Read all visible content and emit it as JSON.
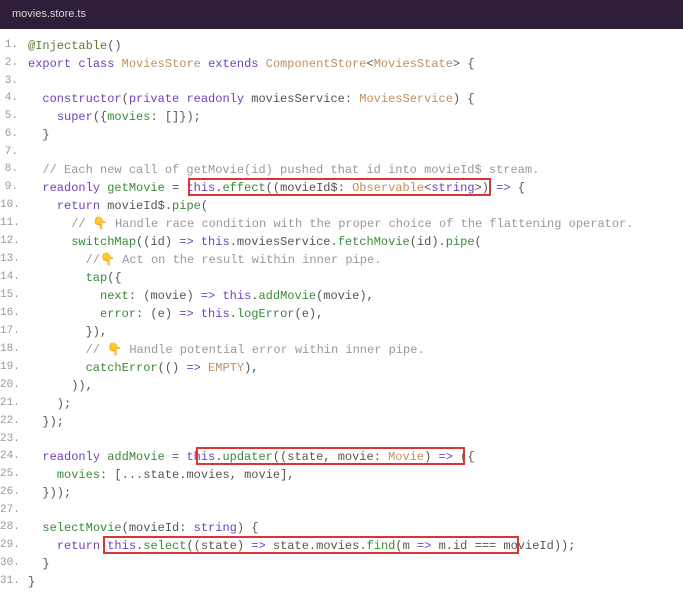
{
  "header": {
    "filename": "movies.store.ts"
  },
  "code": {
    "lines": [
      {
        "n": 1,
        "tokens": [
          [
            "@Injectable",
            "k-decorator"
          ],
          [
            "()",
            "k-punct"
          ]
        ]
      },
      {
        "n": 2,
        "tokens": [
          [
            "export ",
            "k-keyword"
          ],
          [
            "class ",
            "k-keyword"
          ],
          [
            "MoviesStore ",
            "k-class"
          ],
          [
            "extends ",
            "k-keyword"
          ],
          [
            "ComponentStore",
            "k-class"
          ],
          [
            "<",
            "k-punct"
          ],
          [
            "MoviesState",
            "k-class"
          ],
          [
            ">",
            "k-punct"
          ],
          [
            " {",
            "k-punct"
          ]
        ]
      },
      {
        "n": 3,
        "tokens": []
      },
      {
        "n": 4,
        "tokens": [
          [
            "  ",
            "k-plain"
          ],
          [
            "constructor",
            "k-keyword"
          ],
          [
            "(",
            "k-punct"
          ],
          [
            "private ",
            "k-keyword"
          ],
          [
            "readonly ",
            "k-keyword"
          ],
          [
            "moviesService",
            "k-plain"
          ],
          [
            ": ",
            "k-punct"
          ],
          [
            "MoviesService",
            "k-class"
          ],
          [
            ")",
            "k-punct"
          ],
          [
            " {",
            "k-punct"
          ]
        ]
      },
      {
        "n": 5,
        "tokens": [
          [
            "    ",
            "k-plain"
          ],
          [
            "super",
            "k-keyword"
          ],
          [
            "({",
            "k-punct"
          ],
          [
            "movies",
            "k-prop"
          ],
          [
            ": []});",
            "k-punct"
          ]
        ]
      },
      {
        "n": 6,
        "tokens": [
          [
            "  }",
            "k-punct"
          ]
        ]
      },
      {
        "n": 7,
        "tokens": []
      },
      {
        "n": 8,
        "tokens": [
          [
            "  ",
            "k-plain"
          ],
          [
            "// Each new call of getMovie(id) pushed that id into movieId$ stream.",
            "k-comment"
          ]
        ]
      },
      {
        "n": 9,
        "tokens": [
          [
            "  ",
            "k-plain"
          ],
          [
            "readonly ",
            "k-keyword"
          ],
          [
            "getMovie",
            "k-prop"
          ],
          [
            " = ",
            "k-punct"
          ],
          [
            "this",
            "k-this"
          ],
          [
            ".",
            "k-punct"
          ],
          [
            "effect",
            "k-method"
          ],
          [
            "((",
            "k-punct"
          ],
          [
            "movieId$",
            "k-plain"
          ],
          [
            ": ",
            "k-punct"
          ],
          [
            "Observable",
            "k-class"
          ],
          [
            "<",
            "k-punct"
          ],
          [
            "string",
            "k-type"
          ],
          [
            ">) ",
            "k-punct"
          ],
          [
            "=>",
            "k-keyword"
          ],
          [
            " {",
            "k-punct"
          ]
        ],
        "highlight": "hl1"
      },
      {
        "n": 10,
        "tokens": [
          [
            "    ",
            "k-plain"
          ],
          [
            "return ",
            "k-keyword"
          ],
          [
            "movieId$",
            "k-plain"
          ],
          [
            ".",
            "k-punct"
          ],
          [
            "pipe",
            "k-method"
          ],
          [
            "(",
            "k-punct"
          ]
        ]
      },
      {
        "n": 11,
        "tokens": [
          [
            "      ",
            "k-plain"
          ],
          [
            "// 👇 Handle race condition with the proper choice of the flattening operator.",
            "k-comment"
          ]
        ]
      },
      {
        "n": 12,
        "tokens": [
          [
            "      ",
            "k-plain"
          ],
          [
            "switchMap",
            "k-method"
          ],
          [
            "((",
            "k-punct"
          ],
          [
            "id",
            "k-plain"
          ],
          [
            ") ",
            "k-punct"
          ],
          [
            "=>",
            "k-keyword"
          ],
          [
            " ",
            "k-plain"
          ],
          [
            "this",
            "k-this"
          ],
          [
            ".",
            "k-punct"
          ],
          [
            "moviesService",
            "k-plain"
          ],
          [
            ".",
            "k-punct"
          ],
          [
            "fetchMovie",
            "k-method"
          ],
          [
            "(",
            "k-punct"
          ],
          [
            "id",
            "k-plain"
          ],
          [
            ").",
            "k-punct"
          ],
          [
            "pipe",
            "k-method"
          ],
          [
            "(",
            "k-punct"
          ]
        ]
      },
      {
        "n": 13,
        "tokens": [
          [
            "        ",
            "k-plain"
          ],
          [
            "//👇 Act on the result within inner pipe.",
            "k-comment"
          ]
        ]
      },
      {
        "n": 14,
        "tokens": [
          [
            "        ",
            "k-plain"
          ],
          [
            "tap",
            "k-method"
          ],
          [
            "({",
            "k-punct"
          ]
        ]
      },
      {
        "n": 15,
        "tokens": [
          [
            "          ",
            "k-plain"
          ],
          [
            "next",
            "k-prop"
          ],
          [
            ": (",
            "k-punct"
          ],
          [
            "movie",
            "k-plain"
          ],
          [
            ") ",
            "k-punct"
          ],
          [
            "=>",
            "k-keyword"
          ],
          [
            " ",
            "k-plain"
          ],
          [
            "this",
            "k-this"
          ],
          [
            ".",
            "k-punct"
          ],
          [
            "addMovie",
            "k-method"
          ],
          [
            "(",
            "k-punct"
          ],
          [
            "movie",
            "k-plain"
          ],
          [
            "),",
            "k-punct"
          ]
        ]
      },
      {
        "n": 16,
        "tokens": [
          [
            "          ",
            "k-plain"
          ],
          [
            "error",
            "k-prop"
          ],
          [
            ": (",
            "k-punct"
          ],
          [
            "e",
            "k-plain"
          ],
          [
            ") ",
            "k-punct"
          ],
          [
            "=>",
            "k-keyword"
          ],
          [
            " ",
            "k-plain"
          ],
          [
            "this",
            "k-this"
          ],
          [
            ".",
            "k-punct"
          ],
          [
            "logError",
            "k-method"
          ],
          [
            "(",
            "k-punct"
          ],
          [
            "e",
            "k-plain"
          ],
          [
            "),",
            "k-punct"
          ]
        ]
      },
      {
        "n": 17,
        "tokens": [
          [
            "        }),",
            "k-punct"
          ]
        ]
      },
      {
        "n": 18,
        "tokens": [
          [
            "        ",
            "k-plain"
          ],
          [
            "// 👇 Handle potential error within inner pipe.",
            "k-comment"
          ]
        ]
      },
      {
        "n": 19,
        "tokens": [
          [
            "        ",
            "k-plain"
          ],
          [
            "catchError",
            "k-method"
          ],
          [
            "(() ",
            "k-punct"
          ],
          [
            "=>",
            "k-keyword"
          ],
          [
            " ",
            "k-plain"
          ],
          [
            "EMPTY",
            "k-class"
          ],
          [
            "),",
            "k-punct"
          ]
        ]
      },
      {
        "n": 20,
        "tokens": [
          [
            "      )),",
            "k-punct"
          ]
        ]
      },
      {
        "n": 21,
        "tokens": [
          [
            "    );",
            "k-punct"
          ]
        ]
      },
      {
        "n": 22,
        "tokens": [
          [
            "  });",
            "k-punct"
          ]
        ]
      },
      {
        "n": 23,
        "tokens": []
      },
      {
        "n": 24,
        "tokens": [
          [
            "  ",
            "k-plain"
          ],
          [
            "readonly ",
            "k-keyword"
          ],
          [
            "addMovie",
            "k-prop"
          ],
          [
            " = ",
            "k-punct"
          ],
          [
            "this",
            "k-this"
          ],
          [
            ".",
            "k-punct"
          ],
          [
            "updater",
            "k-method"
          ],
          [
            "((",
            "k-punct"
          ],
          [
            "state",
            "k-plain"
          ],
          [
            ", ",
            "k-punct"
          ],
          [
            "movie",
            "k-plain"
          ],
          [
            ": ",
            "k-punct"
          ],
          [
            "Movie",
            "k-class"
          ],
          [
            ") ",
            "k-punct"
          ],
          [
            "=>",
            "k-keyword"
          ],
          [
            " ({",
            "k-punct"
          ]
        ],
        "highlight": "hl2"
      },
      {
        "n": 25,
        "tokens": [
          [
            "    ",
            "k-plain"
          ],
          [
            "movies",
            "k-prop"
          ],
          [
            ": [...",
            "k-punct"
          ],
          [
            "state",
            "k-plain"
          ],
          [
            ".",
            "k-punct"
          ],
          [
            "movies",
            "k-plain"
          ],
          [
            ", ",
            "k-punct"
          ],
          [
            "movie",
            "k-plain"
          ],
          [
            "],",
            "k-punct"
          ]
        ]
      },
      {
        "n": 26,
        "tokens": [
          [
            "  }));",
            "k-punct"
          ]
        ]
      },
      {
        "n": 27,
        "tokens": []
      },
      {
        "n": 28,
        "tokens": [
          [
            "  ",
            "k-plain"
          ],
          [
            "selectMovie",
            "k-method"
          ],
          [
            "(",
            "k-punct"
          ],
          [
            "movieId",
            "k-plain"
          ],
          [
            ": ",
            "k-punct"
          ],
          [
            "string",
            "k-type"
          ],
          [
            ") {",
            "k-punct"
          ]
        ]
      },
      {
        "n": 29,
        "tokens": [
          [
            "    ",
            "k-plain"
          ],
          [
            "return ",
            "k-keyword"
          ],
          [
            "this",
            "k-this"
          ],
          [
            ".",
            "k-punct"
          ],
          [
            "select",
            "k-method"
          ],
          [
            "((",
            "k-punct"
          ],
          [
            "state",
            "k-plain"
          ],
          [
            ") ",
            "k-punct"
          ],
          [
            "=>",
            "k-keyword"
          ],
          [
            " ",
            "k-plain"
          ],
          [
            "state",
            "k-plain"
          ],
          [
            ".",
            "k-punct"
          ],
          [
            "movies",
            "k-plain"
          ],
          [
            ".",
            "k-punct"
          ],
          [
            "find",
            "k-method"
          ],
          [
            "(",
            "k-punct"
          ],
          [
            "m",
            "k-plain"
          ],
          [
            " ",
            "k-plain"
          ],
          [
            "=>",
            "k-keyword"
          ],
          [
            " ",
            "k-plain"
          ],
          [
            "m",
            "k-plain"
          ],
          [
            ".",
            "k-punct"
          ],
          [
            "id",
            "k-plain"
          ],
          [
            " === ",
            "k-punct"
          ],
          [
            "movieId",
            "k-plain"
          ],
          [
            "));",
            "k-punct"
          ]
        ],
        "highlight": "hl3"
      },
      {
        "n": 30,
        "tokens": [
          [
            "  }",
            "k-punct"
          ]
        ]
      },
      {
        "n": 31,
        "tokens": [
          [
            "}",
            "k-punct"
          ]
        ]
      }
    ]
  }
}
